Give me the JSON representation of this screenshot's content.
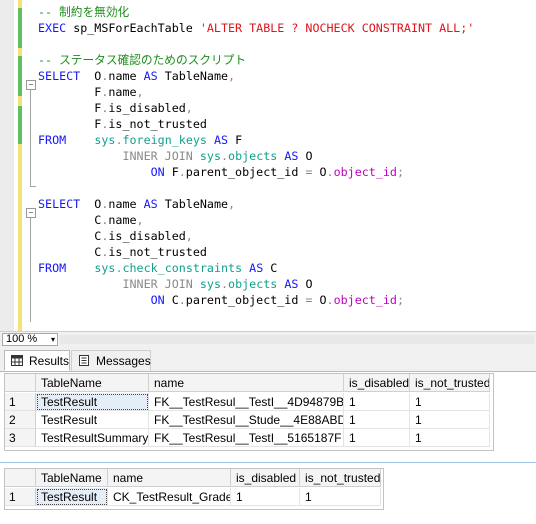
{
  "editor": {
    "lines": [
      {
        "row": 1,
        "tokens": [
          {
            "t": "-- 制約を無効化",
            "c": "com"
          }
        ]
      },
      {
        "row": 2,
        "tokens": [
          {
            "t": "EXEC",
            "c": "kw"
          },
          {
            "t": " sp_MSForEachTable ",
            "c": "plain"
          },
          {
            "t": "'ALTER TABLE ? NOCHECK CONSTRAINT ALL;'",
            "c": "str"
          }
        ]
      },
      {
        "row": 4,
        "tokens": [
          {
            "t": "-- ステータス確認のためのスクリプト",
            "c": "com"
          }
        ]
      },
      {
        "row": 5,
        "tokens": [
          {
            "t": "SELECT",
            "c": "kw"
          },
          {
            "t": "  O",
            "c": "plain"
          },
          {
            "t": ".",
            "c": "grey"
          },
          {
            "t": "name ",
            "c": "plain"
          },
          {
            "t": "AS",
            "c": "kw"
          },
          {
            "t": " TableName",
            "c": "plain"
          },
          {
            "t": ",",
            "c": "grey"
          }
        ]
      },
      {
        "row": 6,
        "tokens": [
          {
            "t": "        F",
            "c": "plain"
          },
          {
            "t": ".",
            "c": "grey"
          },
          {
            "t": "name",
            "c": "plain"
          },
          {
            "t": ",",
            "c": "grey"
          }
        ]
      },
      {
        "row": 7,
        "tokens": [
          {
            "t": "        F",
            "c": "plain"
          },
          {
            "t": ".",
            "c": "grey"
          },
          {
            "t": "is_disabled",
            "c": "plain"
          },
          {
            "t": ",",
            "c": "grey"
          }
        ]
      },
      {
        "row": 8,
        "tokens": [
          {
            "t": "        F",
            "c": "plain"
          },
          {
            "t": ".",
            "c": "grey"
          },
          {
            "t": "is_not_trusted",
            "c": "plain"
          }
        ]
      },
      {
        "row": 9,
        "tokens": [
          {
            "t": "FROM",
            "c": "kw"
          },
          {
            "t": "    ",
            "c": "plain"
          },
          {
            "t": "sys",
            "c": "sys"
          },
          {
            "t": ".",
            "c": "grey"
          },
          {
            "t": "foreign_keys",
            "c": "sys"
          },
          {
            "t": " ",
            "c": "plain"
          },
          {
            "t": "AS",
            "c": "kw"
          },
          {
            "t": " F",
            "c": "plain"
          }
        ]
      },
      {
        "row": 10,
        "tokens": [
          {
            "t": "            ",
            "c": "plain"
          },
          {
            "t": "INNER JOIN",
            "c": "grey"
          },
          {
            "t": " ",
            "c": "plain"
          },
          {
            "t": "sys",
            "c": "sys"
          },
          {
            "t": ".",
            "c": "grey"
          },
          {
            "t": "objects",
            "c": "sys"
          },
          {
            "t": " ",
            "c": "plain"
          },
          {
            "t": "AS",
            "c": "kw"
          },
          {
            "t": " O",
            "c": "plain"
          }
        ]
      },
      {
        "row": 11,
        "tokens": [
          {
            "t": "                ",
            "c": "plain"
          },
          {
            "t": "ON",
            "c": "kw"
          },
          {
            "t": " F",
            "c": "plain"
          },
          {
            "t": ".",
            "c": "grey"
          },
          {
            "t": "parent_object_id ",
            "c": "plain"
          },
          {
            "t": "=",
            "c": "grey"
          },
          {
            "t": " O",
            "c": "plain"
          },
          {
            "t": ".",
            "c": "grey"
          },
          {
            "t": "object_id",
            "c": "mag"
          },
          {
            "t": ";",
            "c": "grey"
          }
        ]
      },
      {
        "row": 13,
        "tokens": [
          {
            "t": "SELECT",
            "c": "kw"
          },
          {
            "t": "  O",
            "c": "plain"
          },
          {
            "t": ".",
            "c": "grey"
          },
          {
            "t": "name ",
            "c": "plain"
          },
          {
            "t": "AS",
            "c": "kw"
          },
          {
            "t": " TableName",
            "c": "plain"
          },
          {
            "t": ",",
            "c": "grey"
          }
        ]
      },
      {
        "row": 14,
        "tokens": [
          {
            "t": "        C",
            "c": "plain"
          },
          {
            "t": ".",
            "c": "grey"
          },
          {
            "t": "name",
            "c": "plain"
          },
          {
            "t": ",",
            "c": "grey"
          }
        ]
      },
      {
        "row": 15,
        "tokens": [
          {
            "t": "        C",
            "c": "plain"
          },
          {
            "t": ".",
            "c": "grey"
          },
          {
            "t": "is_disabled",
            "c": "plain"
          },
          {
            "t": ",",
            "c": "grey"
          }
        ]
      },
      {
        "row": 16,
        "tokens": [
          {
            "t": "        C",
            "c": "plain"
          },
          {
            "t": ".",
            "c": "grey"
          },
          {
            "t": "is_not_trusted",
            "c": "plain"
          }
        ]
      },
      {
        "row": 17,
        "tokens": [
          {
            "t": "FROM",
            "c": "kw"
          },
          {
            "t": "    ",
            "c": "plain"
          },
          {
            "t": "sys",
            "c": "sys"
          },
          {
            "t": ".",
            "c": "grey"
          },
          {
            "t": "check_constraints",
            "c": "sys"
          },
          {
            "t": " ",
            "c": "plain"
          },
          {
            "t": "AS",
            "c": "kw"
          },
          {
            "t": " C",
            "c": "plain"
          }
        ]
      },
      {
        "row": 18,
        "tokens": [
          {
            "t": "            ",
            "c": "plain"
          },
          {
            "t": "INNER JOIN",
            "c": "grey"
          },
          {
            "t": " ",
            "c": "plain"
          },
          {
            "t": "sys",
            "c": "sys"
          },
          {
            "t": ".",
            "c": "grey"
          },
          {
            "t": "objects",
            "c": "sys"
          },
          {
            "t": " ",
            "c": "plain"
          },
          {
            "t": "AS",
            "c": "kw"
          },
          {
            "t": " O",
            "c": "plain"
          }
        ]
      },
      {
        "row": 19,
        "tokens": [
          {
            "t": "                ",
            "c": "plain"
          },
          {
            "t": "ON",
            "c": "kw"
          },
          {
            "t": " C",
            "c": "plain"
          },
          {
            "t": ".",
            "c": "grey"
          },
          {
            "t": "parent_object_id ",
            "c": "plain"
          },
          {
            "t": "=",
            "c": "grey"
          },
          {
            "t": " O",
            "c": "plain"
          },
          {
            "t": ".",
            "c": "grey"
          },
          {
            "t": "object_id",
            "c": "mag"
          },
          {
            "t": ";",
            "c": "grey"
          }
        ]
      }
    ],
    "collapse_symbol": "−"
  },
  "zoom": {
    "value": "100 %",
    "arrow": "▾"
  },
  "tabs": {
    "results_label": "Results",
    "messages_label": "Messages"
  },
  "grid1": {
    "columns": [
      "TableName",
      "name",
      "is_disabled",
      "is_not_trusted"
    ],
    "rows": [
      {
        "num": "1",
        "cells": [
          "TestResult",
          "FK__TestResul__TestI__4D94879B",
          "1",
          "1"
        ]
      },
      {
        "num": "2",
        "cells": [
          "TestResult",
          "FK__TestResul__Stude__4E88ABD4",
          "1",
          "1"
        ]
      },
      {
        "num": "3",
        "cells": [
          "TestResultSummary",
          "FK__TestResul__TestI__5165187F",
          "1",
          "1"
        ]
      }
    ]
  },
  "grid2": {
    "columns": [
      "TableName",
      "name",
      "is_disabled",
      "is_not_trusted"
    ],
    "rows": [
      {
        "num": "1",
        "cells": [
          "TestResult",
          "CK_TestResult_Grade",
          "1",
          "1"
        ]
      }
    ]
  },
  "colors": {
    "keyword": "#1515ff",
    "string": "#e0141a",
    "comment": "#1d8d1d",
    "system": "#11a08e",
    "function": "#c000c0",
    "operator": "#8a8a8a"
  }
}
